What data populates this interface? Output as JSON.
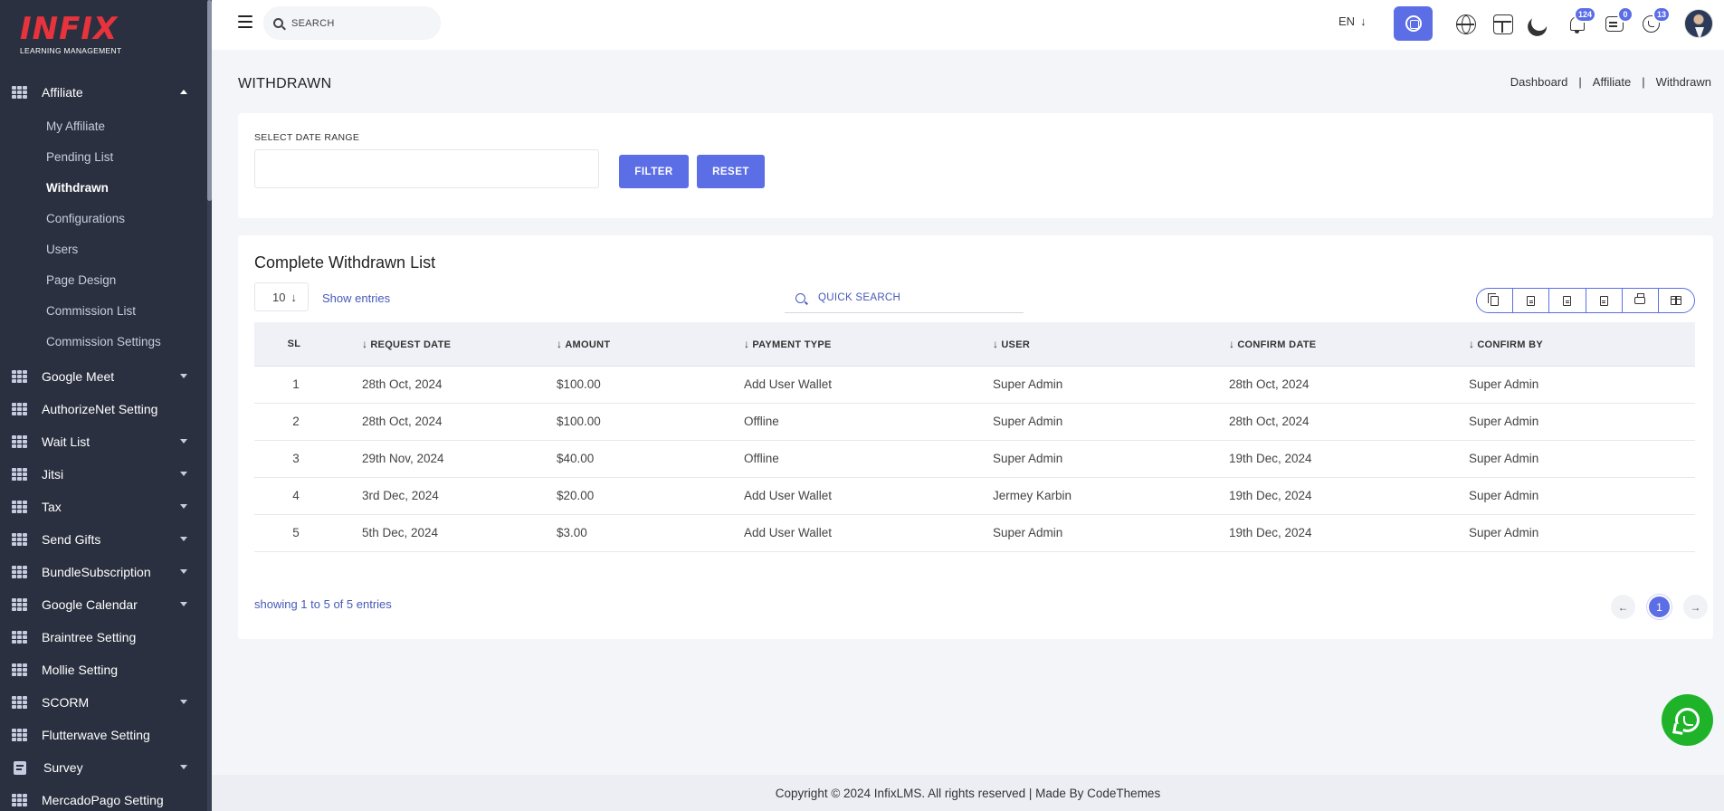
{
  "sidebar": {
    "logo": {
      "brand": "INFIX",
      "tagline": "LEARNING MANAGEMENT"
    },
    "affiliate": {
      "label": "Affiliate",
      "submenu": [
        "My Affiliate",
        "Pending List",
        "Withdrawn",
        "Configurations",
        "Users",
        "Page Design",
        "Commission List",
        "Commission Settings"
      ],
      "active": "Withdrawn"
    },
    "items": [
      {
        "label": "Google Meet",
        "icon": "grid-icon",
        "caret": true
      },
      {
        "label": "AuthorizeNet Setting",
        "icon": "grid-icon",
        "caret": false
      },
      {
        "label": "Wait List",
        "icon": "grid-icon",
        "caret": true
      },
      {
        "label": "Jitsi",
        "icon": "grid-icon",
        "caret": true
      },
      {
        "label": "Tax",
        "icon": "grid-icon",
        "caret": true
      },
      {
        "label": "Send Gifts",
        "icon": "grid-icon",
        "caret": true
      },
      {
        "label": "BundleSubscription",
        "icon": "grid-icon",
        "caret": true
      },
      {
        "label": "Google Calendar",
        "icon": "grid-icon",
        "caret": true
      },
      {
        "label": "Braintree Setting",
        "icon": "grid-icon",
        "caret": false
      },
      {
        "label": "Mollie Setting",
        "icon": "grid-icon",
        "caret": false
      },
      {
        "label": "SCORM",
        "icon": "grid-icon",
        "caret": true
      },
      {
        "label": "Flutterwave Setting",
        "icon": "grid-icon",
        "caret": false
      },
      {
        "label": "Survey",
        "icon": "document-icon",
        "caret": true
      },
      {
        "label": "MercadoPago Setting",
        "icon": "grid-icon",
        "caret": false
      }
    ]
  },
  "topbar": {
    "search_placeholder": "SEARCH",
    "language": "EN",
    "notifications_count": "124",
    "messages_count": "0",
    "whatsapp_count": "13"
  },
  "page": {
    "title": "WITHDRAWN",
    "breadcrumb": [
      "Dashboard",
      "Affiliate",
      "Withdrawn"
    ]
  },
  "filter": {
    "label": "SELECT DATE RANGE",
    "date_value": "",
    "filter_label": "FILTER",
    "reset_label": "RESET"
  },
  "list": {
    "title": "Complete Withdrawn List",
    "entries_value": "10",
    "show_entries_label": "Show entries",
    "quick_search_placeholder": "QUICK SEARCH",
    "columns": [
      "SL",
      "REQUEST DATE",
      "AMOUNT",
      "PAYMENT TYPE",
      "USER",
      "CONFIRM DATE",
      "CONFIRM BY"
    ],
    "rows": [
      {
        "sl": "1",
        "request_date": "28th Oct, 2024",
        "amount": "$100.00",
        "payment_type": "Add User Wallet",
        "user": "Super Admin",
        "confirm_date": "28th Oct, 2024",
        "confirm_by": "Super Admin"
      },
      {
        "sl": "2",
        "request_date": "28th Oct, 2024",
        "amount": "$100.00",
        "payment_type": "Offline",
        "user": "Super Admin",
        "confirm_date": "28th Oct, 2024",
        "confirm_by": "Super Admin"
      },
      {
        "sl": "3",
        "request_date": "29th Nov, 2024",
        "amount": "$40.00",
        "payment_type": "Offline",
        "user": "Super Admin",
        "confirm_date": "19th Dec, 2024",
        "confirm_by": "Super Admin"
      },
      {
        "sl": "4",
        "request_date": "3rd Dec, 2024",
        "amount": "$20.00",
        "payment_type": "Add User Wallet",
        "user": "Jermey Karbin",
        "confirm_date": "19th Dec, 2024",
        "confirm_by": "Super Admin"
      },
      {
        "sl": "5",
        "request_date": "5th Dec, 2024",
        "amount": "$3.00",
        "payment_type": "Add User Wallet",
        "user": "Super Admin",
        "confirm_date": "19th Dec, 2024",
        "confirm_by": "Super Admin"
      }
    ],
    "showing_text": "showing 1 to 5 of 5 entries",
    "current_page": "1"
  },
  "footer": {
    "text": "Copyright © 2024 InfixLMS. All rights reserved | Made By CodeThemes"
  },
  "colors": {
    "accent": "#5b6ee6",
    "sidebar_bg": "#2b3040",
    "whatsapp": "#1fb32a"
  }
}
